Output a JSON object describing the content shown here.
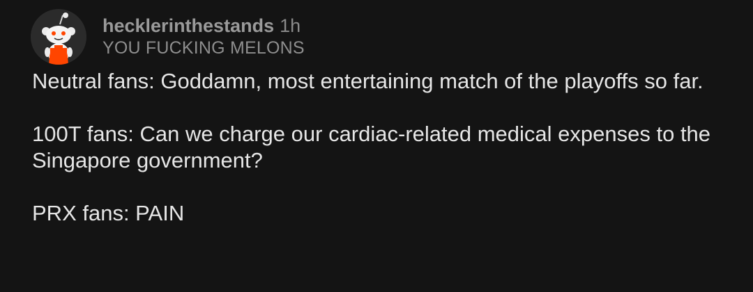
{
  "comment": {
    "author": "hecklerinthestands",
    "age": "1h",
    "flair": "YOU FUCKING MELONS",
    "avatar_icon": "snoo-avatar-icon",
    "paragraphs": [
      "Neutral fans: Goddamn, most entertaining match of the playoffs so far.",
      "100T fans: Can we charge our cardiac-related medical expenses to the Singapore government?",
      "PRX fans: PAIN"
    ]
  },
  "colors": {
    "background": "#141414",
    "text": "#e6e6e6",
    "meta": "#9a9a9a",
    "avatar_accent": "#ff4500"
  }
}
